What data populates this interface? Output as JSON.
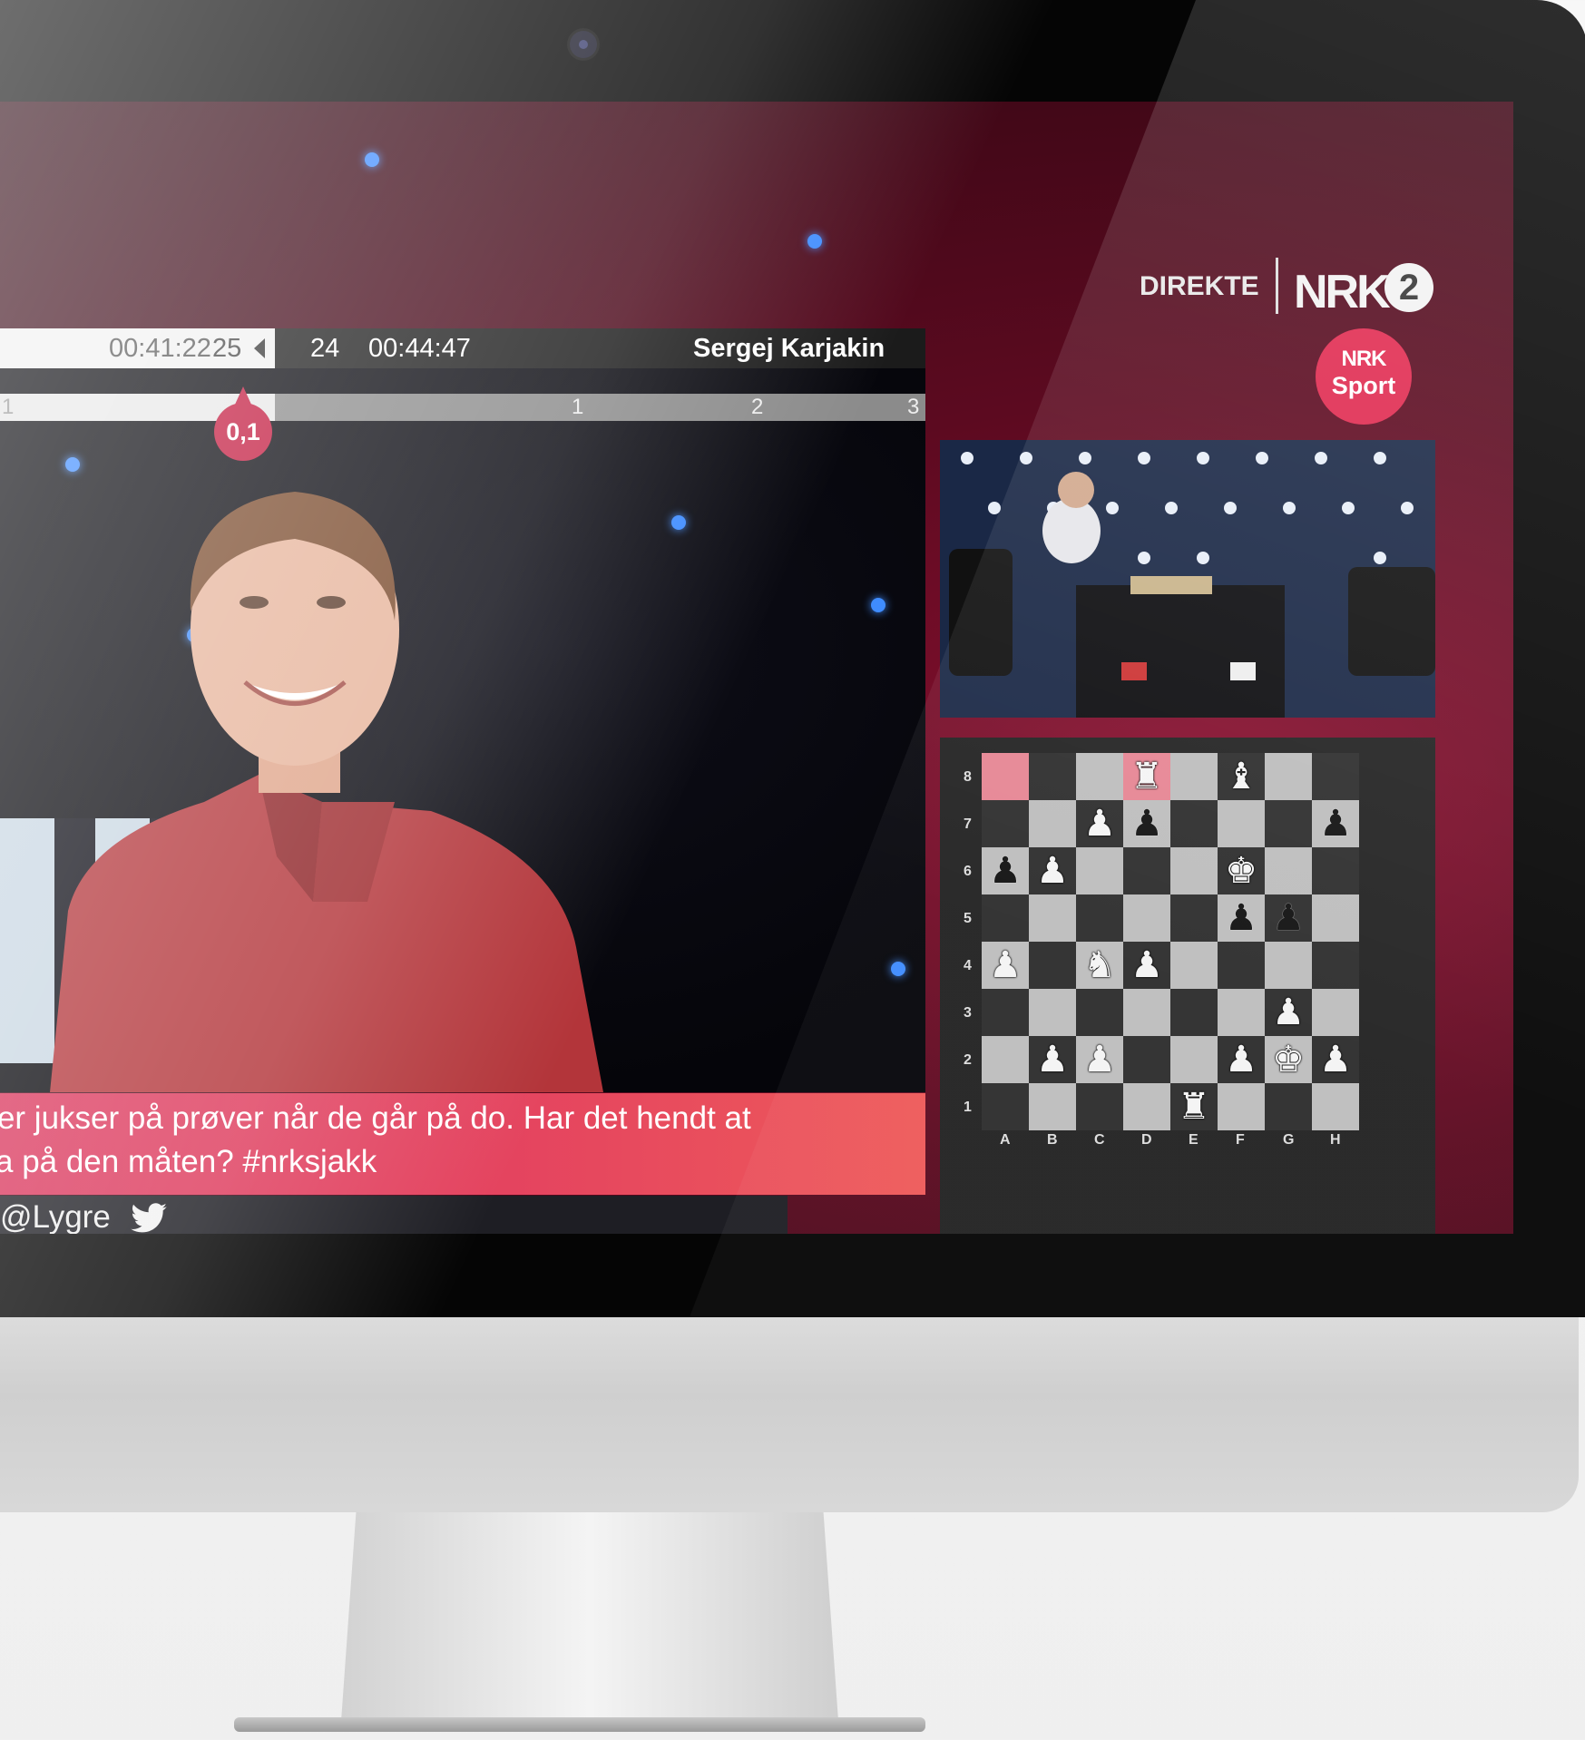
{
  "scoreboard": {
    "left_clock": "00:41:22",
    "left_move": "25",
    "right_move": "24",
    "right_clock": "00:44:47",
    "right_player": "Sergej Karjakin"
  },
  "eval": {
    "ticks": [
      "1",
      "1",
      "2",
      "3"
    ],
    "value": "0,1"
  },
  "ticker": {
    "line1": "ever jukser på prøver når de går på do. Har det hendt at",
    "line2": "ksa på den måten? #nrksjakk",
    "handle": "@Lygre"
  },
  "branding": {
    "live": "DIREKTE",
    "channel": "NRK",
    "channel_number": "2",
    "sport_logo_top": "NRK",
    "sport_logo_bottom": "Sport"
  },
  "board": {
    "files": [
      "A",
      "B",
      "C",
      "D",
      "E",
      "F",
      "G",
      "H"
    ],
    "ranks": [
      "8",
      "7",
      "6",
      "5",
      "4",
      "3",
      "2",
      "1"
    ],
    "highlight_squares": [
      "a8",
      "d8"
    ],
    "pieces": [
      {
        "sq": "d8",
        "glyph": "♜",
        "color": "white"
      },
      {
        "sq": "f8",
        "glyph": "♝",
        "color": "white"
      },
      {
        "sq": "c7",
        "glyph": "♟",
        "color": "white"
      },
      {
        "sq": "d7",
        "glyph": "♟",
        "color": "black"
      },
      {
        "sq": "h7",
        "glyph": "♟",
        "color": "black"
      },
      {
        "sq": "a6",
        "glyph": "♟",
        "color": "black"
      },
      {
        "sq": "b6",
        "glyph": "♟",
        "color": "white"
      },
      {
        "sq": "f6",
        "glyph": "♚",
        "color": "white"
      },
      {
        "sq": "f5",
        "glyph": "♟",
        "color": "black"
      },
      {
        "sq": "g5",
        "glyph": "♟",
        "color": "black"
      },
      {
        "sq": "a4",
        "glyph": "♟",
        "color": "white"
      },
      {
        "sq": "c4",
        "glyph": "♞",
        "color": "white"
      },
      {
        "sq": "d4",
        "glyph": "♟",
        "color": "white"
      },
      {
        "sq": "g3",
        "glyph": "♟",
        "color": "white"
      },
      {
        "sq": "b2",
        "glyph": "♟",
        "color": "white"
      },
      {
        "sq": "c2",
        "glyph": "♟",
        "color": "white"
      },
      {
        "sq": "f2",
        "glyph": "♟",
        "color": "white"
      },
      {
        "sq": "g2",
        "glyph": "♚",
        "color": "white"
      },
      {
        "sq": "h2",
        "glyph": "♟",
        "color": "white"
      },
      {
        "sq": "e1",
        "glyph": "♜",
        "color": "white"
      }
    ]
  },
  "colors": {
    "accent": "#e0294f",
    "ticker": "#d9345c",
    "light_square": "#bdbdbd",
    "dark_square": "#2d2d2d",
    "highlight": "#e68593"
  }
}
